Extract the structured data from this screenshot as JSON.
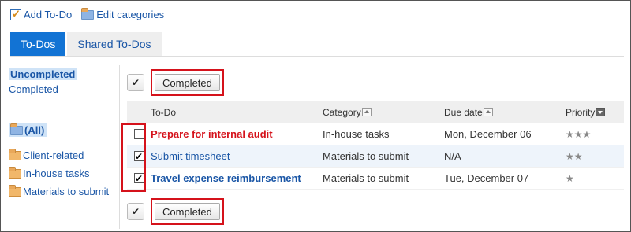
{
  "toolbar": {
    "add_todo": "Add To-Do",
    "edit_categories": "Edit categories"
  },
  "tabs": [
    {
      "label": "To-Dos",
      "active": true
    },
    {
      "label": "Shared To-Dos",
      "active": false
    }
  ],
  "sidebar": {
    "statuses": [
      {
        "label": "Uncompleted",
        "selected": true
      },
      {
        "label": "Completed",
        "selected": false
      }
    ],
    "categories": [
      {
        "label": "(All)",
        "selected": true
      },
      {
        "label": "Client-related",
        "selected": false
      },
      {
        "label": "In-house tasks",
        "selected": false
      },
      {
        "label": "Materials to submit",
        "selected": false
      }
    ]
  },
  "actions": {
    "check_all_glyph": "✔",
    "completed_label": "Completed"
  },
  "table": {
    "headers": {
      "todo": "To-Do",
      "category": "Category",
      "due_date": "Due date",
      "priority": "Priority"
    },
    "rows": [
      {
        "checked": false,
        "todo": "Prepare for internal audit",
        "category": "In-house tasks",
        "due_date": "Mon, December 06",
        "priority": "★★★",
        "priority_level": 3
      },
      {
        "checked": true,
        "todo": "Submit timesheet",
        "category": "Materials to submit",
        "due_date": "N/A",
        "priority": "★★",
        "priority_level": 2
      },
      {
        "checked": true,
        "todo": "Travel expense reimbursement",
        "category": "Materials to submit",
        "due_date": "Tue, December 07",
        "priority": "★",
        "priority_level": 1
      }
    ]
  },
  "colors": {
    "accent": "#1273d4",
    "link": "#1a56a6",
    "overdue": "#d5121b",
    "highlight": "#d5121b"
  }
}
